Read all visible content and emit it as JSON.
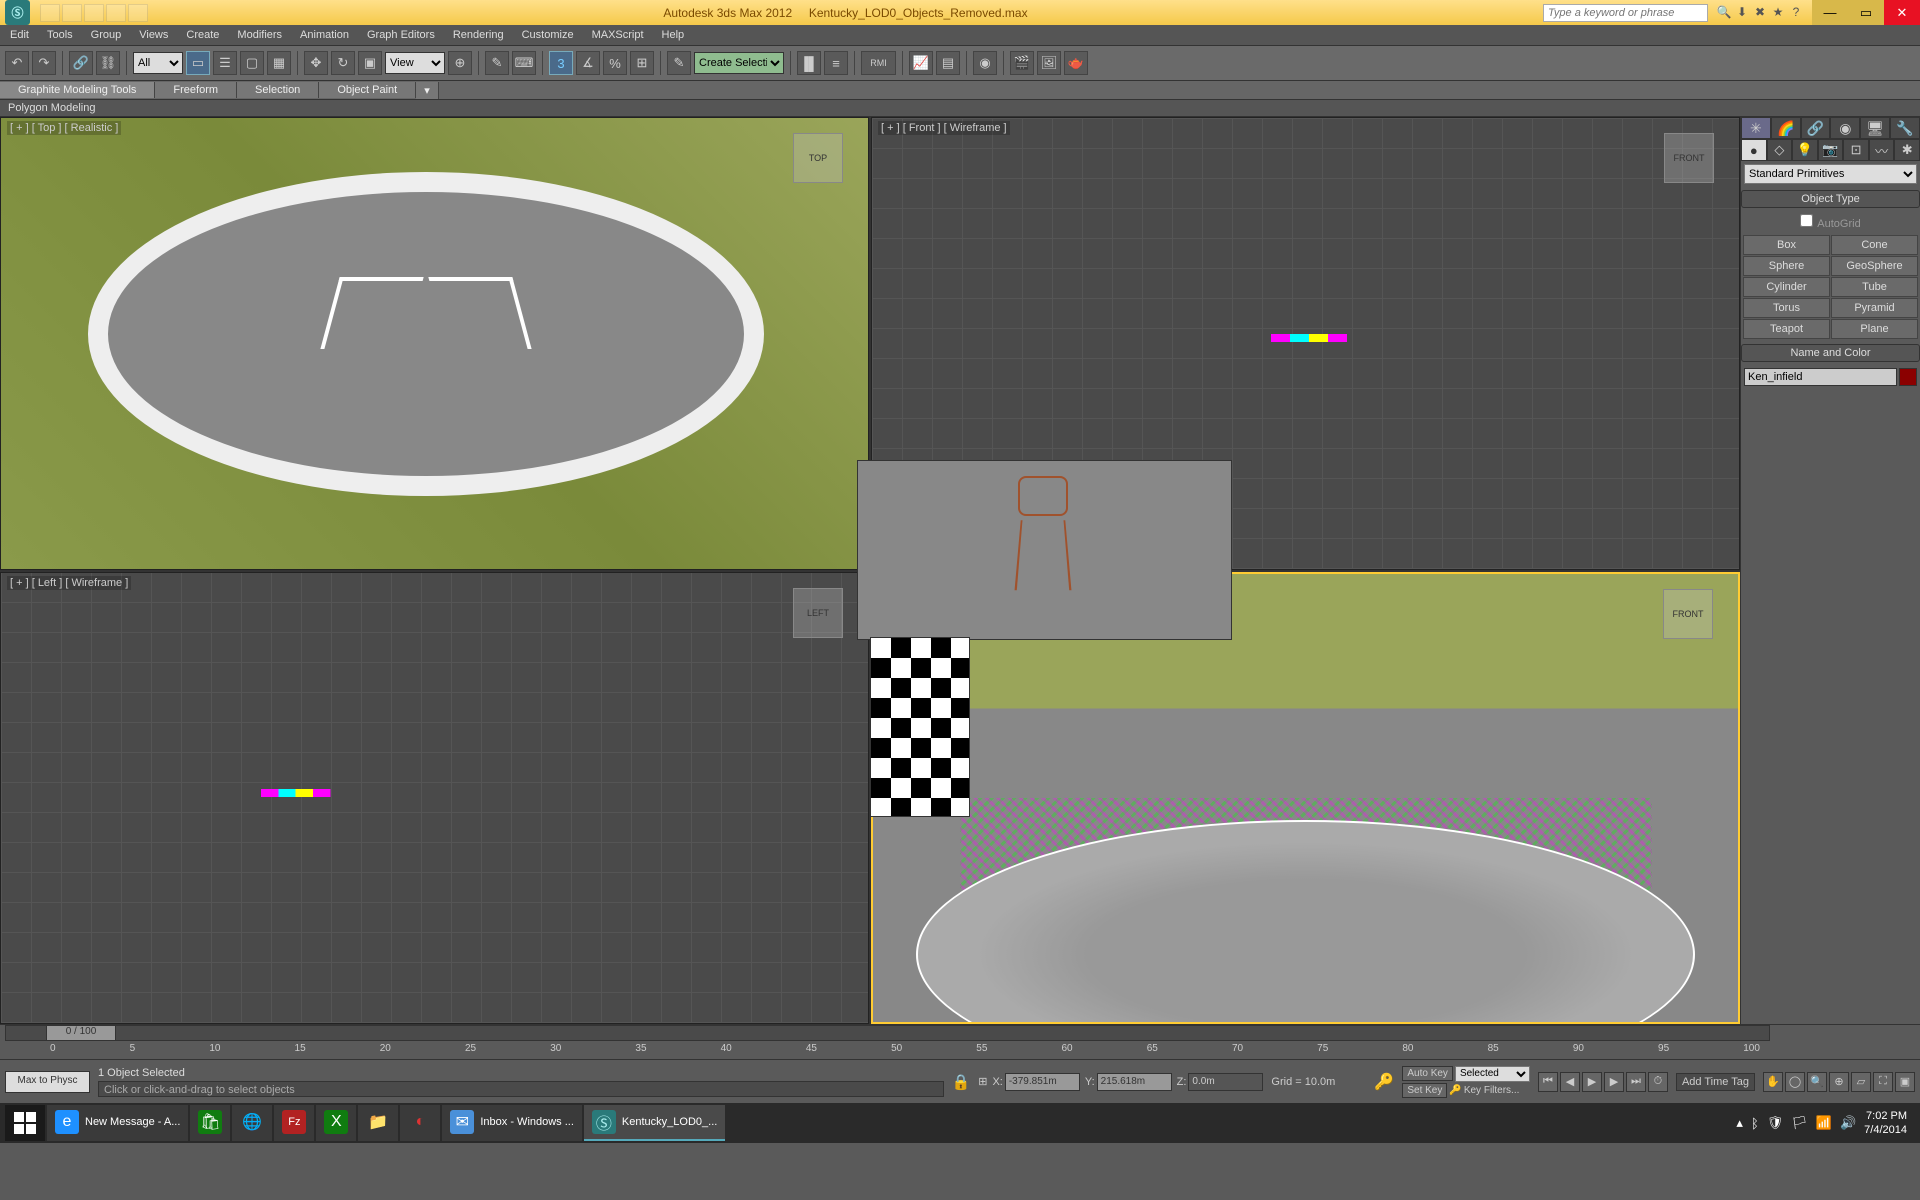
{
  "title": {
    "app": "Autodesk 3ds Max  2012",
    "file": "Kentucky_LOD0_Objects_Removed.max",
    "search_placeholder": "Type a keyword or phrase"
  },
  "menu": [
    "Edit",
    "Tools",
    "Group",
    "Views",
    "Create",
    "Modifiers",
    "Animation",
    "Graph Editors",
    "Rendering",
    "Customize",
    "MAXScript",
    "Help"
  ],
  "toolbar": {
    "all": "All",
    "view": "View",
    "sel_set": "Create Selection Se",
    "rmi": "RMI"
  },
  "ribbon": {
    "tabs": [
      "Graphite Modeling Tools",
      "Freeform",
      "Selection",
      "Object Paint"
    ],
    "sub": "Polygon Modeling"
  },
  "viewports": {
    "tl": "[ + ] [ Top ] [ Realistic ]",
    "tl_cube": "TOP",
    "tr": "[ + ] [ Front ] [ Wireframe ]",
    "tr_cube": "FRONT",
    "bl": "[ + ] [ Left ] [ Wireframe ]",
    "bl_cube": "LEFT",
    "br_cube": "FRONT"
  },
  "cmd": {
    "dropdown": "Standard Primitives",
    "rollout1": "Object Type",
    "autogrid": "AutoGrid",
    "prims": [
      "Box",
      "Cone",
      "Sphere",
      "GeoSphere",
      "Cylinder",
      "Tube",
      "Torus",
      "Pyramid",
      "Teapot",
      "Plane"
    ],
    "rollout2": "Name and Color",
    "obj_name": "Ken_infield"
  },
  "time": {
    "slider": "0 / 100",
    "ticks": [
      "0",
      "5",
      "10",
      "15",
      "20",
      "25",
      "30",
      "35",
      "40",
      "45",
      "50",
      "55",
      "60",
      "65",
      "70",
      "75",
      "80",
      "85",
      "90",
      "95",
      "100"
    ]
  },
  "status": {
    "script_btn": "Max to Physc",
    "selection": "1 Object Selected",
    "prompt": "Click or click-and-drag to select objects",
    "x": "-379.851m",
    "y": "215.618m",
    "z": "0.0m",
    "grid": "Grid = 10.0m",
    "add_tag": "Add Time Tag",
    "autokey": "Auto Key",
    "selected": "Selected",
    "setkey": "Set Key",
    "keyfilters": "Key Filters..."
  },
  "taskbar": {
    "items": [
      {
        "label": "New Message - A...",
        "color": "#1e90ff",
        "glyph": "e"
      },
      {
        "label": "",
        "color": "#107c10",
        "glyph": "🛍"
      },
      {
        "label": "",
        "color": "#fff",
        "glyph": "●"
      },
      {
        "label": "",
        "color": "#b22222",
        "glyph": "Fz"
      },
      {
        "label": "",
        "color": "#107c10",
        "glyph": "X"
      },
      {
        "label": "",
        "color": "#f5c94a",
        "glyph": "📁"
      },
      {
        "label": "",
        "color": "#d33",
        "glyph": "◐"
      },
      {
        "label": "Inbox - Windows ...",
        "color": "#4a90d9",
        "glyph": "✉"
      },
      {
        "label": "Kentucky_LOD0_...",
        "color": "#2a7a7a",
        "glyph": "Ⓢ"
      }
    ],
    "time": "7:02 PM",
    "date": "7/4/2014"
  }
}
